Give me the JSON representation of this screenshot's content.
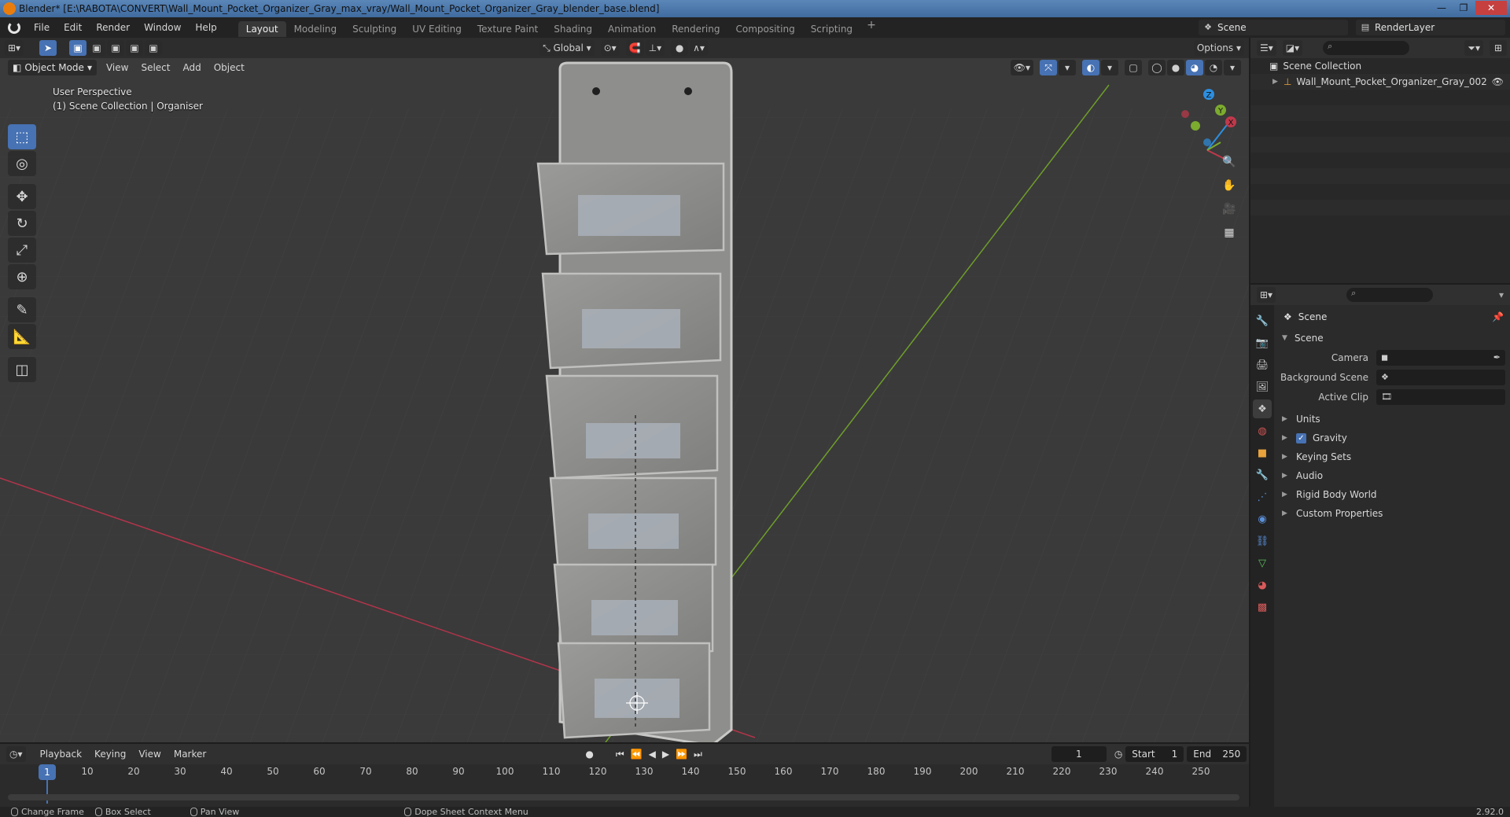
{
  "window": {
    "title": "Blender* [E:\\RABOTA\\CONVERT\\Wall_Mount_Pocket_Organizer_Gray_max_vray/Wall_Mount_Pocket_Organizer_Gray_blender_base.blend]",
    "minimize": "—",
    "maximize": "❐",
    "close": "✕"
  },
  "menu": [
    "File",
    "Edit",
    "Render",
    "Window",
    "Help"
  ],
  "workspaces": [
    "Layout",
    "Modeling",
    "Sculpting",
    "UV Editing",
    "Texture Paint",
    "Shading",
    "Animation",
    "Rendering",
    "Compositing",
    "Scripting"
  ],
  "workspace_add": "+",
  "scene_selector": "Scene",
  "renderlayer_selector": "RenderLayer",
  "viewport": {
    "transform_orientation": "Global",
    "options": "Options",
    "mode": "Object Mode",
    "menus": [
      "View",
      "Select",
      "Add",
      "Object"
    ],
    "info_line1": "User Perspective",
    "info_line2": "(1) Scene Collection | Organiser",
    "gizmo": {
      "x": "X",
      "y": "Y",
      "z": "Z"
    }
  },
  "outliner": {
    "root": "Scene Collection",
    "object": "Wall_Mount_Pocket_Organizer_Gray_002"
  },
  "properties": {
    "context": "Scene",
    "panel": "Scene",
    "camera_label": "Camera",
    "background_scene_label": "Background Scene",
    "active_clip_label": "Active Clip",
    "subpanels": [
      "Units",
      "Gravity",
      "Keying Sets",
      "Audio",
      "Rigid Body World",
      "Custom Properties"
    ],
    "gravity_checked": true
  },
  "timeline": {
    "menus": [
      "Playback",
      "Keying",
      "View",
      "Marker"
    ],
    "current_frame": "1",
    "start_label": "Start",
    "start": "1",
    "end_label": "End",
    "end": "250",
    "ruler": [
      "1",
      "10",
      "20",
      "30",
      "40",
      "50",
      "60",
      "70",
      "80",
      "90",
      "100",
      "110",
      "120",
      "130",
      "140",
      "150",
      "160",
      "170",
      "180",
      "190",
      "200",
      "210",
      "220",
      "230",
      "240",
      "250"
    ]
  },
  "status": {
    "items": [
      "Change Frame",
      "Box Select",
      "Pan View",
      "Dope Sheet Context Menu"
    ],
    "version": "2.92.0"
  },
  "colors": {
    "accent": "#4772b3",
    "x_axis": "#c0394b",
    "y_axis": "#7cab2e",
    "z_axis": "#2c8fe0"
  }
}
